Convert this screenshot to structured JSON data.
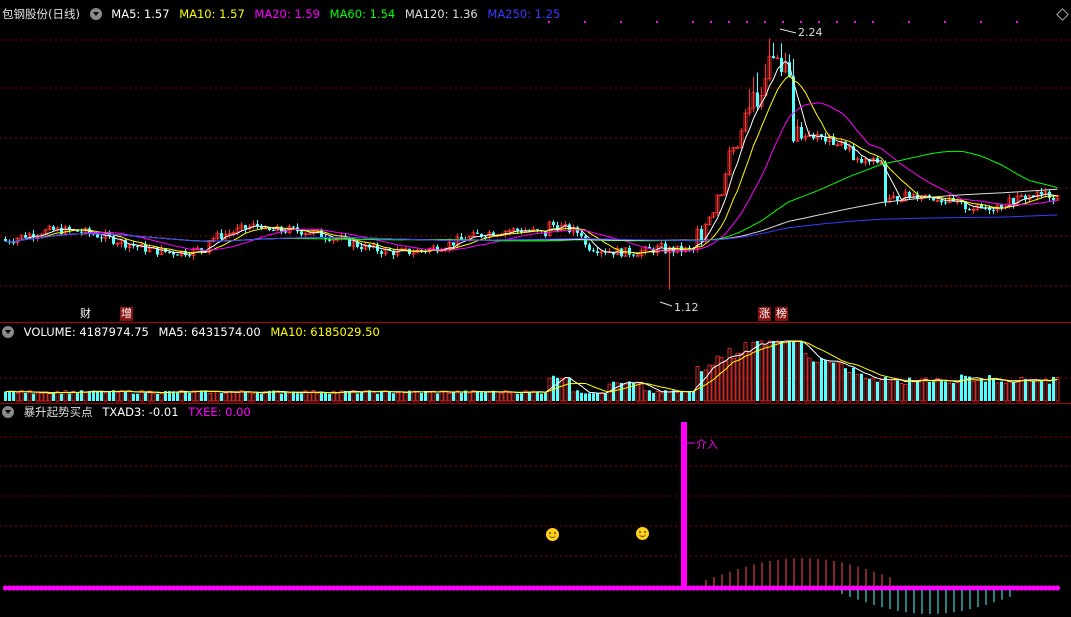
{
  "main_header": {
    "title": "包钢股份(日线)",
    "ma5": "MA5: 1.57",
    "ma10": "MA10: 1.57",
    "ma20": "MA20: 1.59",
    "ma60": "MA60: 1.54",
    "ma120": "MA120: 1.36",
    "ma250": "MA250: 1.25"
  },
  "price_labels": {
    "high": "2.24",
    "low": "1.12"
  },
  "event_tags": {
    "cai": "财",
    "zeng": "增",
    "zhang": "涨",
    "bang": "榜"
  },
  "volume_header": {
    "volume": "VOLUME: 4187974.75",
    "ma5": "MA5: 6431574.00",
    "ma10": "MA10: 6185029.50"
  },
  "indicator_header": {
    "name": "暴升起势买点",
    "txad3": "TXAD3: -0.01",
    "txee": "TXEE: 0.00"
  },
  "indicator_labels": {
    "entry": "介入"
  },
  "colors": {
    "up": "#ff3232",
    "down": "#54ffff",
    "ma5": "#ffffff",
    "ma10": "#ffff00",
    "ma20": "#ff00ff",
    "ma60": "#00ff00",
    "ma120": "#dddddd",
    "ma250": "#3a3aff",
    "grid": "#8a0000",
    "separator": "#b00000"
  },
  "icons": [
    "dropdown-icon",
    "smiley-icon",
    "diamond-icon"
  ]
}
